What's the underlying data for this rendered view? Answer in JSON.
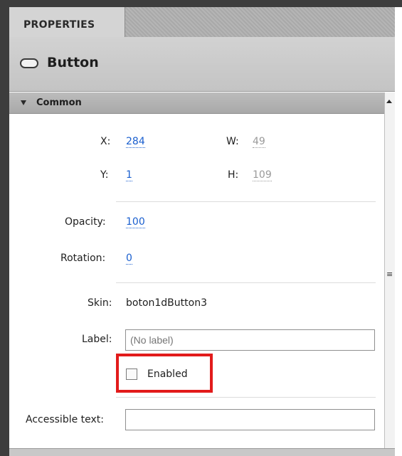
{
  "panel": {
    "tab_label": "PROPERTIES",
    "component_name": "Button"
  },
  "section": {
    "title": "Common"
  },
  "fields": {
    "x_label": "X:",
    "x_value": "284",
    "w_label": "W:",
    "w_value": "49",
    "y_label": "Y:",
    "y_value": "1",
    "h_label": "H:",
    "h_value": "109",
    "opacity_label": "Opacity:",
    "opacity_value": "100",
    "rotation_label": "Rotation:",
    "rotation_value": "0",
    "skin_label": "Skin:",
    "skin_value": "boton1dButton3",
    "label_label": "Label:",
    "label_placeholder": "(No label)",
    "enabled_label": "Enabled",
    "enabled_checked": false,
    "accessible_label": "Accessible text:",
    "accessible_value": ""
  },
  "colors": {
    "link": "#1a5fcf",
    "highlight": "#e21b1b"
  }
}
